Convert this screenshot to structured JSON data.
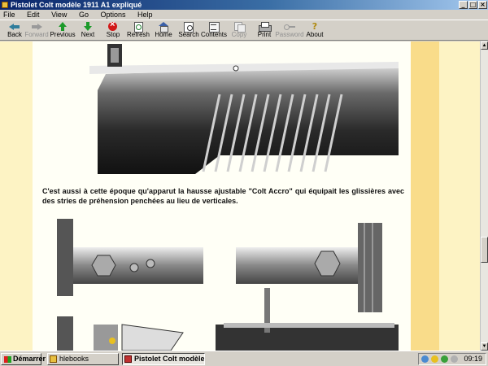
{
  "window": {
    "title": "Pistolet Colt modèle 1911 A1 expliqué"
  },
  "menu": [
    "File",
    "Edit",
    "View",
    "Go",
    "Options",
    "Help"
  ],
  "toolbar": [
    {
      "label": "Back",
      "icon": "back-arrow-icon",
      "enabled": true
    },
    {
      "label": "Forward",
      "icon": "forward-arrow-icon",
      "enabled": false
    },
    {
      "label": "Previous",
      "icon": "up-arrow-icon",
      "enabled": true
    },
    {
      "label": "Next",
      "icon": "down-arrow-icon",
      "enabled": true
    },
    {
      "label": "Stop",
      "icon": "stop-icon",
      "enabled": true
    },
    {
      "label": "Refresh",
      "icon": "refresh-icon",
      "enabled": true
    },
    {
      "label": "Home",
      "icon": "home-icon",
      "enabled": true
    },
    {
      "label": "Search",
      "icon": "search-icon",
      "enabled": true
    },
    {
      "label": "Contents",
      "icon": "contents-icon",
      "enabled": true
    },
    {
      "label": "Copy",
      "icon": "copy-icon",
      "enabled": false
    },
    {
      "label": "Print",
      "icon": "print-icon",
      "enabled": true
    },
    {
      "label": "Password",
      "icon": "key-icon",
      "enabled": false
    },
    {
      "label": "About",
      "icon": "help-icon",
      "enabled": true
    }
  ],
  "article": {
    "paragraph": "C'est aussi à cette époque qu'apparut la hausse ajustable \"Colt Accro\" qui équipait les glissières avec des stries de préhension penchées au lieu de verticales."
  },
  "taskbar": {
    "start_label": "Démarrer",
    "tasks": [
      {
        "label": "hlebooks",
        "active": false
      },
      {
        "label": "Pistolet Colt modèle 1...",
        "active": true
      }
    ],
    "clock": "09:19"
  }
}
